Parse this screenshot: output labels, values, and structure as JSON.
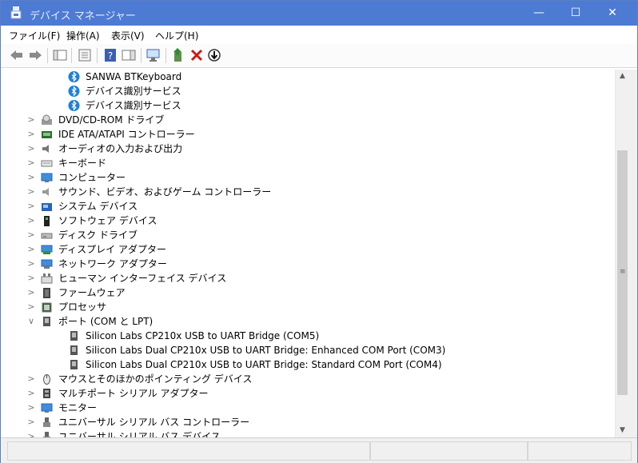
{
  "window": {
    "title": "デバイス マネージャー",
    "minimize": "—",
    "maximize": "☐",
    "close": "✕"
  },
  "menu": [
    "ファイル(F)",
    "操作(A)",
    "表示(V)",
    "ヘルプ(H)"
  ],
  "toolbar": [
    {
      "icon": "back-arrow-icon"
    },
    {
      "icon": "forward-arrow-icon"
    },
    {
      "icon": "show-hide-console-tree-icon"
    },
    {
      "icon": "properties-icon"
    },
    {
      "icon": "help-icon"
    },
    {
      "icon": "action-pane-icon"
    },
    {
      "icon": "scan-hardware-changes-icon"
    },
    {
      "icon": "update-driver-icon"
    },
    {
      "icon": "uninstall-device-icon"
    },
    {
      "icon": "disable-device-icon"
    }
  ],
  "tree": [
    {
      "label": "SANWA BTKeyboard",
      "level": 2,
      "expander": "",
      "icon": "bluetooth-icon"
    },
    {
      "label": "デバイス識別サービス",
      "level": 2,
      "expander": "",
      "icon": "bluetooth-icon"
    },
    {
      "label": "デバイス識別サービス",
      "level": 2,
      "expander": "",
      "icon": "bluetooth-icon"
    },
    {
      "label": "DVD/CD-ROM ドライブ",
      "level": 1,
      "expander": ">",
      "icon": "dvd-drive-icon"
    },
    {
      "label": "IDE ATA/ATAPI コントローラー",
      "level": 1,
      "expander": ">",
      "icon": "ide-controller-icon"
    },
    {
      "label": "オーディオの入力および出力",
      "level": 1,
      "expander": ">",
      "icon": "speaker-icon"
    },
    {
      "label": "キーボード",
      "level": 1,
      "expander": ">",
      "icon": "keyboard-icon"
    },
    {
      "label": "コンピューター",
      "level": 1,
      "expander": ">",
      "icon": "computer-icon"
    },
    {
      "label": "サウンド、ビデオ、およびゲーム コントローラー",
      "level": 1,
      "expander": ">",
      "icon": "sound-icon"
    },
    {
      "label": "システム デバイス",
      "level": 1,
      "expander": ">",
      "icon": "system-folder-icon"
    },
    {
      "label": "ソフトウェア デバイス",
      "level": 1,
      "expander": ">",
      "icon": "software-device-icon"
    },
    {
      "label": "ディスク ドライブ",
      "level": 1,
      "expander": ">",
      "icon": "disk-drive-icon"
    },
    {
      "label": "ディスプレイ アダプター",
      "level": 1,
      "expander": ">",
      "icon": "display-adapter-icon"
    },
    {
      "label": "ネットワーク アダプター",
      "level": 1,
      "expander": ">",
      "icon": "network-adapter-icon"
    },
    {
      "label": "ヒューマン インターフェイス デバイス",
      "level": 1,
      "expander": ">",
      "icon": "hid-icon"
    },
    {
      "label": "ファームウェア",
      "level": 1,
      "expander": ">",
      "icon": "firmware-icon"
    },
    {
      "label": "プロセッサ",
      "level": 1,
      "expander": ">",
      "icon": "processor-icon"
    },
    {
      "label": "ポート (COM と LPT)",
      "level": 1,
      "expander": "∨",
      "icon": "port-icon"
    },
    {
      "label": "Silicon Labs CP210x USB to UART Bridge (COM5)",
      "level": 2,
      "expander": "",
      "icon": "port-icon"
    },
    {
      "label": "Silicon Labs Dual CP210x USB to UART Bridge: Enhanced COM Port (COM3)",
      "level": 2,
      "expander": "",
      "icon": "port-icon"
    },
    {
      "label": "Silicon Labs Dual CP210x USB to UART Bridge: Standard COM Port (COM4)",
      "level": 2,
      "expander": "",
      "icon": "port-icon"
    },
    {
      "label": "マウスとそのほかのポインティング デバイス",
      "level": 1,
      "expander": ">",
      "icon": "mouse-icon"
    },
    {
      "label": "マルチポート シリアル アダプター",
      "level": 1,
      "expander": ">",
      "icon": "multiport-icon"
    },
    {
      "label": "モニター",
      "level": 1,
      "expander": ">",
      "icon": "monitor-icon"
    },
    {
      "label": "ユニバーサル シリアル バス コントローラー",
      "level": 1,
      "expander": ">",
      "icon": "usb-icon"
    },
    {
      "label": "ユニバーサル シリアル バス デバイス",
      "level": 1,
      "expander": ">",
      "icon": "usb-icon"
    }
  ],
  "scrollbar": {
    "up": "▲",
    "down": "▼",
    "grip": "≡"
  },
  "colors": {
    "titlebar": "#4d7bd3",
    "bluetooth": "#1e7fd9",
    "accent": "#2a62b8"
  }
}
